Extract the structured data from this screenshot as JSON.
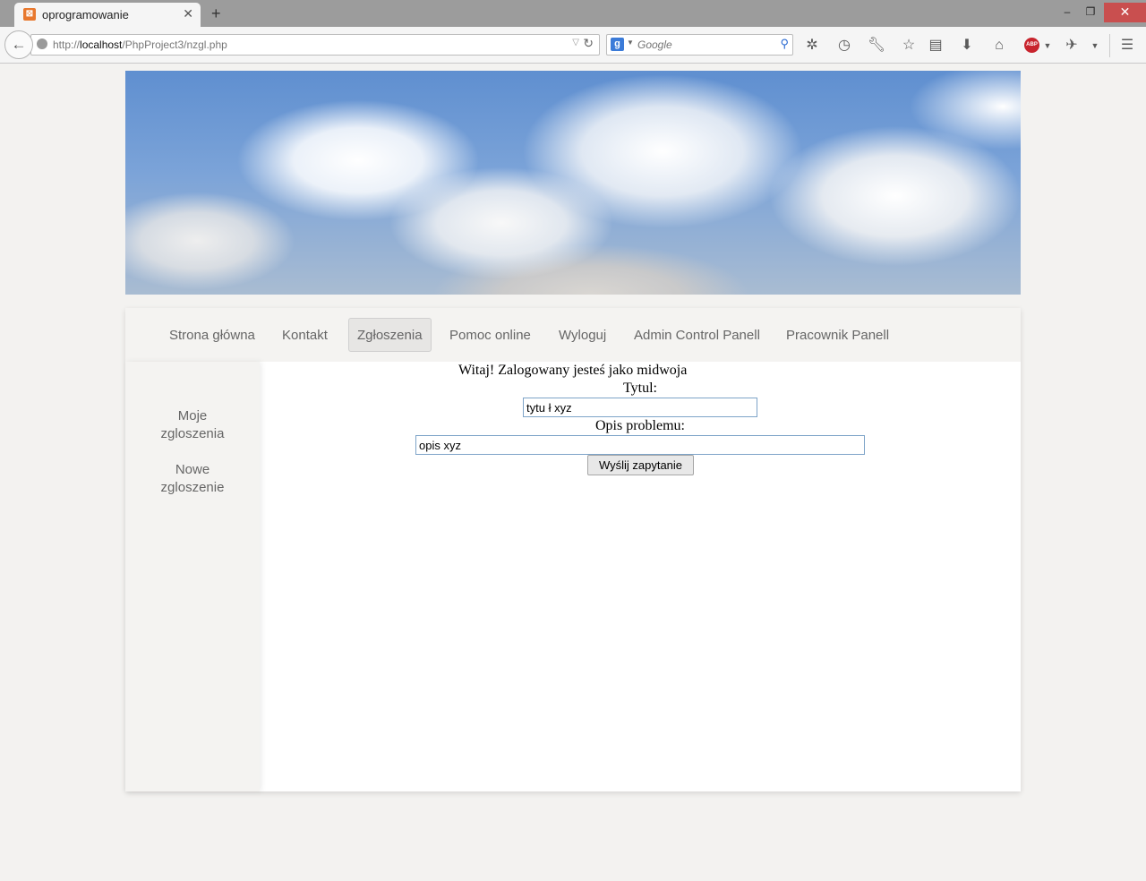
{
  "browser": {
    "tab_title": "oprogramowanie",
    "url_prefix": "http://",
    "url_host": "localhost",
    "url_path": "/PhpProject3/nzgl.php",
    "search_placeholder": "Google",
    "search_engine_letter": "g",
    "adblock_label": "ABP",
    "window_controls": {
      "minimize": "–",
      "maximize": "❐",
      "close": "✕"
    },
    "toolbar_icons": [
      "settings-icon",
      "history-icon",
      "wrench-icon",
      "bookmark-star-icon",
      "reading-list-icon",
      "download-icon",
      "home-icon",
      "adblock-icon",
      "extension-icon",
      "menu-icon"
    ]
  },
  "nav": {
    "items": [
      {
        "label": "Strona główna"
      },
      {
        "label": "Kontakt"
      },
      {
        "label": "Zgłoszenia",
        "active": true
      },
      {
        "label": "Pomoc online"
      },
      {
        "label": "Wyloguj"
      },
      {
        "label": "Admin Control Panell"
      },
      {
        "label": "Pracownik Panell"
      }
    ]
  },
  "sidebar": {
    "links": [
      {
        "line1": "Moje",
        "line2": "zgloszenia"
      },
      {
        "line1": "Nowe",
        "line2": "zgloszenie"
      }
    ]
  },
  "form": {
    "welcome": "Witaj! Zalogowany jesteś jako midwoja",
    "title_label": "Tytul:",
    "title_value": "tytu ł xyz",
    "desc_label": "Opis problemu:",
    "desc_value": "opis xyz",
    "submit_label": "Wyślij zapytanie"
  },
  "colors": {
    "page_bg": "#f3f2f0",
    "chrome_bg": "#9c9c9c",
    "field_border": "#7ea4c8",
    "close_button": "#c94f4f"
  }
}
